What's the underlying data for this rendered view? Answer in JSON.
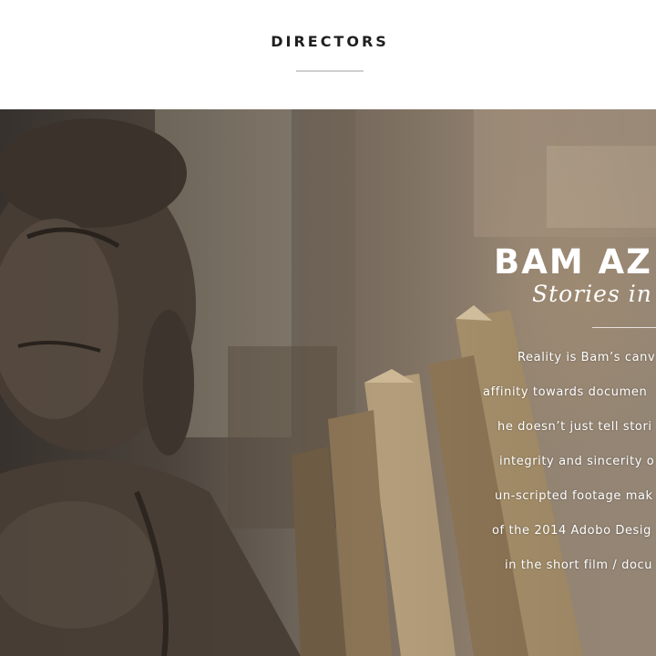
{
  "header": {
    "section_title": "DIRECTORS"
  },
  "hero": {
    "director_name": "BAM AZ",
    "tagline": "Stories in N",
    "bio_lines": [
      "Reality is Bam’s canv",
      "affinity towards documen",
      "he doesn’t just tell stori",
      "integrity and sincerity o",
      "un-scripted footage mak",
      "of the 2014 Adobo Desig",
      "in the short film / docu"
    ]
  }
}
